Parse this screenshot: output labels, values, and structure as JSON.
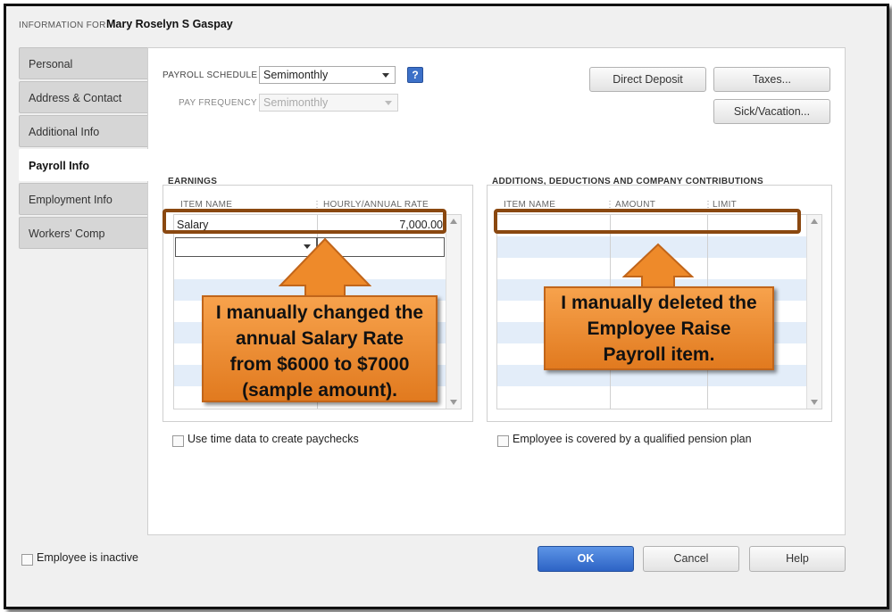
{
  "header": {
    "info_for_label": "INFORMATION FOR",
    "employee_name": "Mary Roselyn S Gaspay"
  },
  "tabs": [
    {
      "label": "Personal",
      "active": false
    },
    {
      "label": "Address & Contact",
      "active": false
    },
    {
      "label": "Additional Info",
      "active": false
    },
    {
      "label": "Payroll Info",
      "active": true
    },
    {
      "label": "Employment Info",
      "active": false
    },
    {
      "label": "Workers' Comp",
      "active": false
    }
  ],
  "payroll": {
    "schedule_label": "PAYROLL SCHEDULE",
    "schedule_value": "Semimonthly",
    "frequency_label": "PAY FREQUENCY",
    "frequency_value": "Semimonthly",
    "help_glyph": "?"
  },
  "buttons": {
    "direct_deposit": "Direct Deposit",
    "taxes": "Taxes...",
    "sick_vacation": "Sick/Vacation..."
  },
  "earnings": {
    "title": "EARNINGS",
    "columns": [
      "ITEM NAME",
      "HOURLY/ANNUAL RATE"
    ],
    "rows": [
      {
        "item": "Salary",
        "rate": "7,000.00"
      }
    ]
  },
  "additions": {
    "title": "ADDITIONS, DEDUCTIONS AND COMPANY CONTRIBUTIONS",
    "columns": [
      "ITEM NAME",
      "AMOUNT",
      "LIMIT"
    ]
  },
  "checkboxes": {
    "use_time_data": "Use time data to create paychecks",
    "pension_plan": "Employee is covered by a qualified pension plan",
    "inactive": "Employee is inactive"
  },
  "footer": {
    "ok": "OK",
    "cancel": "Cancel",
    "help": "Help"
  },
  "callouts": {
    "earnings": [
      "I manually changed the",
      "annual  Salary Rate",
      "from $6000 to $7000",
      "(sample amount)."
    ],
    "additions": [
      "I manually deleted the",
      "Employee Raise",
      "Payroll item."
    ]
  },
  "colors": {
    "callout_fill": "#f0922f",
    "highlight_border": "#8a4810",
    "ok_button": "#3a72d4",
    "stripe": "#e3edf9"
  }
}
